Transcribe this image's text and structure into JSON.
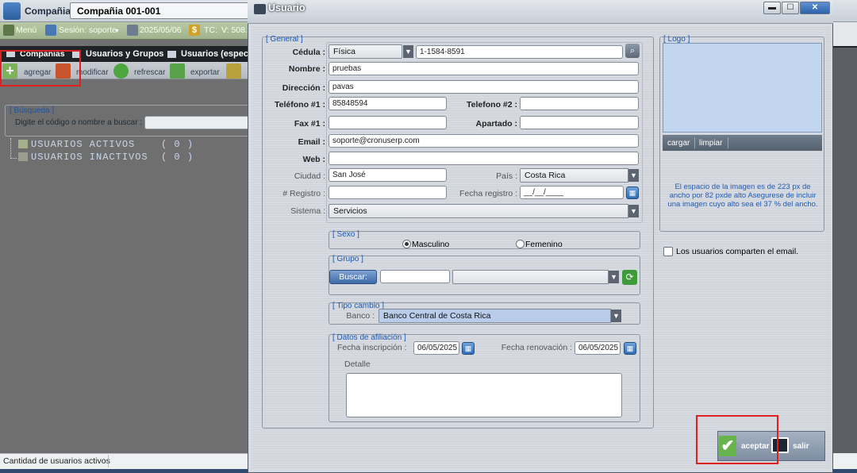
{
  "app": {
    "company_label": "Compañia.",
    "company_value": "Compañia 001-001",
    "toolbar": {
      "menu": "Menú",
      "session": "Sesión: soporte",
      "date": "2025/05/06",
      "tc": "TC:",
      "tc_value": "V: 508.8"
    },
    "tabs": [
      "Companias",
      "Usuarios y Grupos",
      "Usuarios (especia"
    ],
    "ribbon": [
      "agregar",
      "modificar",
      "refrescar",
      "exportar"
    ],
    "search": {
      "group_label": "[ Búsqueda ]",
      "hint": "Digite el código o nombre a buscar :"
    },
    "tree": {
      "active": "USUARIOS ACTIVOS    ( 0 )",
      "inactive": "USUARIOS INACTIVOS  ( 0 )"
    },
    "status": "Cantidad de usuarios activos"
  },
  "dialog": {
    "title": "Usuario",
    "general": {
      "group_label": "[ General ]",
      "cedula_label": "Cédula :",
      "cedula_type": "Física",
      "cedula_value": "1-1584-8591",
      "nombre_label": "Nombre :",
      "nombre_value": "pruebas",
      "direccion_label": "Dirección :",
      "direccion_value": "pavas",
      "tel1_label": "Teléfono #1 :",
      "tel1_value": "85848594",
      "tel2_label": "Telefono #2 :",
      "tel2_value": "",
      "fax_label": "Fax #1 :",
      "fax_value": "",
      "apartado_label": "Apartado :",
      "apartado_value": "",
      "email_label": "Email :",
      "email_value": "soporte@cronuserp.com",
      "web_label": "Web :",
      "web_value": "",
      "ciudad_label": "Ciudad :",
      "ciudad_value": "San José",
      "pais_label": "País :",
      "pais_value": "Costa Rica",
      "registro_label": "# Registro :",
      "registro_value": "",
      "fecha_registro_label": "Fecha registro :",
      "fecha_registro_value": "__/__/____",
      "sistema_label": "Sistema :",
      "sistema_value": "Servicios"
    },
    "sexo": {
      "group_label": "[ Sexo ]",
      "masculino": "Masculino",
      "femenino": "Femenino",
      "selected": "Masculino"
    },
    "grupo": {
      "group_label": "[ Grupo ]",
      "buscar": "Buscar:",
      "code": "",
      "name": ""
    },
    "tipo_cambio": {
      "group_label": "[ Tipo cambio ]",
      "banco_label": "Banco :",
      "banco_value": "Banco Central de Costa Rica"
    },
    "afiliacion": {
      "group_label": "[ Datos de afiliación ]",
      "inscripcion_label": "Fecha inscripción :",
      "inscripcion_value": "06/05/2025",
      "renovacion_label": "Fecha renovación :",
      "renovacion_value": "06/05/2025",
      "detalle_label": "Detalle",
      "detalle_value": ""
    },
    "logo": {
      "group_label": "[ Logo ]",
      "cargar": "cargar",
      "limpiar": "limpiar",
      "info": "El espacio de la imagen es de 223 px de ancho por 82 pxde alto Asegurese de incluir una imagen cuyo alto sea el 37 % del ancho."
    },
    "share_email": "Los usuarios comparten el email.",
    "aceptar": "aceptar",
    "salir": "salir"
  },
  "colors": {
    "accent_blue": "#1b58b3",
    "highlight_red": "#e01f1f",
    "ok_green": "#67b34d"
  }
}
